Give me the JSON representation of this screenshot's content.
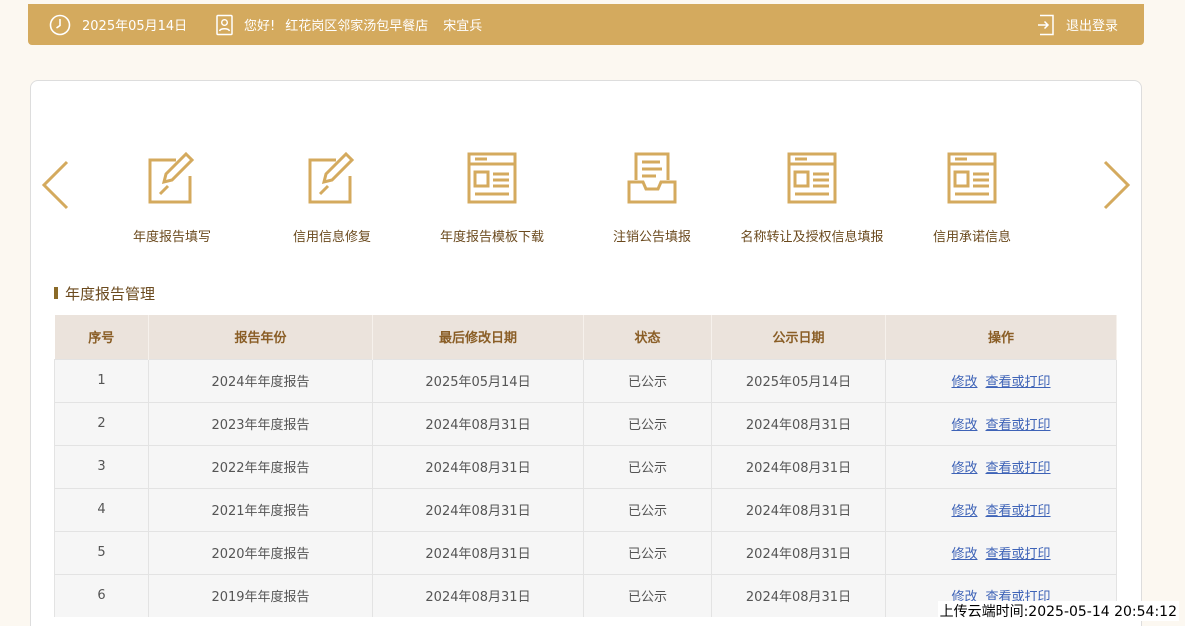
{
  "header": {
    "date": "2025年05月14日",
    "greeting": "您好!",
    "company": "红花岗区邻家汤包早餐店",
    "user": "宋宜兵",
    "logout": "退出登录"
  },
  "functions": [
    {
      "label": "年度报告填写",
      "icon": "edit-icon"
    },
    {
      "label": "信用信息修复",
      "icon": "edit-icon"
    },
    {
      "label": "年度报告模板下载",
      "icon": "document-icon"
    },
    {
      "label": "注销公告填报",
      "icon": "tray-icon"
    },
    {
      "label": "名称转让及授权信息填报",
      "icon": "document-icon"
    },
    {
      "label": "信用承诺信息",
      "icon": "document-icon"
    }
  ],
  "section": {
    "title": "年度报告管理"
  },
  "table": {
    "headers": [
      "序号",
      "报告年份",
      "最后修改日期",
      "状态",
      "公示日期",
      "操作"
    ],
    "rows": [
      {
        "no": "1",
        "year": "2024年年度报告",
        "modified": "2025年05月14日",
        "status": "已公示",
        "published": "2025年05月14日",
        "edit": "修改",
        "view": "查看或打印"
      },
      {
        "no": "2",
        "year": "2023年年度报告",
        "modified": "2024年08月31日",
        "status": "已公示",
        "published": "2024年08月31日",
        "edit": "修改",
        "view": "查看或打印"
      },
      {
        "no": "3",
        "year": "2022年年度报告",
        "modified": "2024年08月31日",
        "status": "已公示",
        "published": "2024年08月31日",
        "edit": "修改",
        "view": "查看或打印"
      },
      {
        "no": "4",
        "year": "2021年年度报告",
        "modified": "2024年08月31日",
        "status": "已公示",
        "published": "2024年08月31日",
        "edit": "修改",
        "view": "查看或打印"
      },
      {
        "no": "5",
        "year": "2020年年度报告",
        "modified": "2024年08月31日",
        "status": "已公示",
        "published": "2024年08月31日",
        "edit": "修改",
        "view": "查看或打印"
      },
      {
        "no": "6",
        "year": "2019年年度报告",
        "modified": "2024年08月31日",
        "status": "已公示",
        "published": "2024年08月31日",
        "edit": "修改",
        "view": "查看或打印"
      }
    ]
  },
  "upload_stamp": "上传云端时间:2025-05-14 20:54:12",
  "colors": {
    "accent": "#d4aa5e",
    "header_text": "#8a5e26",
    "link": "#3e63b7"
  }
}
